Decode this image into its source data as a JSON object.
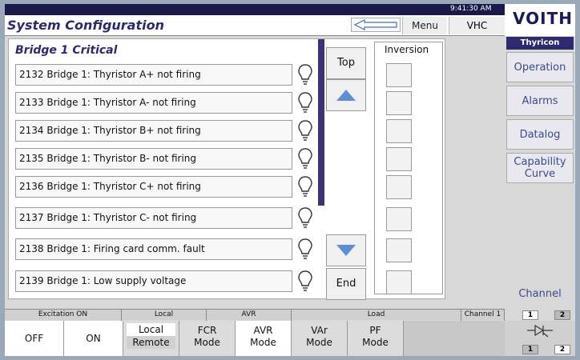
{
  "header": {
    "time": "9:41:30 AM",
    "title": "System Configuration",
    "menu_label": "Menu",
    "vhc_label": "VHC",
    "logo_text": "VOITH"
  },
  "section": {
    "title": "Bridge 1 Critical",
    "alarms": [
      {
        "label": "2132 Bridge 1: Thyristor A+ not firing"
      },
      {
        "label": "2133 Bridge 1: Thyristor A- not firing"
      },
      {
        "label": "2134 Bridge 1: Thyristor B+ not firing"
      },
      {
        "label": "2135 Bridge 1: Thyristor B- not firing"
      },
      {
        "label": "2136 Bridge 1: Thyristor C+ not firing"
      },
      {
        "label": "2137 Bridge 1: Thyristor C- not firing"
      },
      {
        "label": "2138 Bridge 1: Firing card comm. fault"
      },
      {
        "label": "2139 Bridge 1: Low supply voltage"
      }
    ]
  },
  "nav": {
    "top_label": "Top",
    "end_label": "End"
  },
  "inversion": {
    "title": "Inversion"
  },
  "sidebar": {
    "brand": "Thyricon",
    "items": [
      {
        "label": "Operation"
      },
      {
        "label": "Alarms"
      },
      {
        "label": "Datalog"
      },
      {
        "label": "Capability Curve"
      }
    ],
    "channel_label": "Channel",
    "channel_options": [
      "1",
      "2"
    ]
  },
  "status": {
    "excitation": "Excitation ON",
    "location": "Local",
    "mode": "AVR",
    "load": "Load",
    "channel": "Channel 1",
    "channel_segments": [
      "1",
      "2"
    ]
  },
  "bottom": {
    "off": "OFF",
    "on": "ON",
    "local": "Local",
    "remote": "Remote",
    "fcr": [
      "FCR",
      "Mode"
    ],
    "avr": [
      "AVR",
      "Mode"
    ],
    "var": [
      "VAr",
      "Mode"
    ],
    "pf": [
      "PF",
      "Mode"
    ],
    "diode_segments": [
      "1",
      "2"
    ]
  },
  "colors": {
    "accent": "#2d2a70",
    "link": "#3b4d8a",
    "arrow": "#5b8fd6"
  }
}
